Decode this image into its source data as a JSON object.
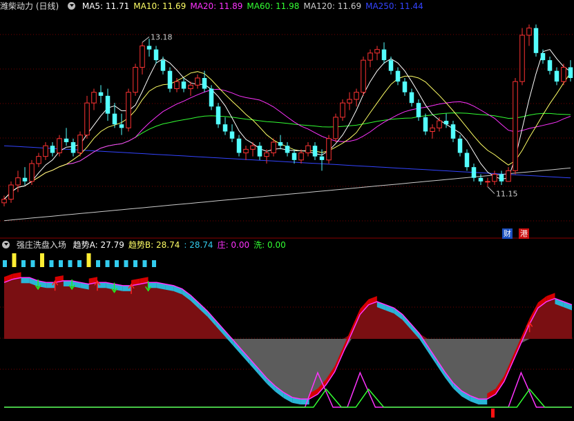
{
  "title": "潍柴动力 (日线)",
  "top_legend": [
    {
      "label": "MA5: 11.71",
      "color": "#ffffff"
    },
    {
      "label": "MA10: 11.69",
      "color": "#ffff66"
    },
    {
      "label": "MA20: 11.89",
      "color": "#ff33ff"
    },
    {
      "label": "MA60: 11.98",
      "color": "#33ff33"
    },
    {
      "label": "MA120: 11.69",
      "color": "#cccccc"
    },
    {
      "label": "MA250: 11.44",
      "color": "#3344ff"
    }
  ],
  "indicator_title": "强庄洗盘入场",
  "bottom_legend": [
    {
      "label": "趋势A: 27.79",
      "color": "#ffffff"
    },
    {
      "label": "趋势B: 28.74",
      "color": "#ffff66"
    },
    {
      "label": ": 28.74",
      "color": "#33ccee"
    },
    {
      "label": "庄: 0.00",
      "color": "#ff33ff"
    },
    {
      "label": "洗: 0.00",
      "color": "#33ff33"
    }
  ],
  "badges": [
    {
      "label": "财",
      "bg": "#1b4fbf"
    },
    {
      "label": "港",
      "bg": "#cc1111"
    }
  ],
  "colors": {
    "up": "#ff3333",
    "down": "#54ffff",
    "fill_red": "#7a0f12",
    "fill_gray": "#5c5c5c",
    "band_cyan": "#2ab4d6",
    "band_red": "#d40000",
    "grid": "#7a0000"
  },
  "chart_data": {
    "type": "candlestick",
    "candles": [
      [
        10.7,
        10.9,
        10.6,
        10.8
      ],
      [
        10.8,
        11.3,
        10.7,
        11.2
      ],
      [
        11.2,
        11.6,
        11.0,
        11.4
      ],
      [
        11.4,
        11.7,
        11.2,
        11.3
      ],
      [
        11.3,
        11.9,
        11.2,
        11.8
      ],
      [
        11.8,
        12.1,
        11.7,
        12.0
      ],
      [
        12.0,
        12.4,
        11.9,
        12.3
      ],
      [
        12.3,
        12.4,
        12.0,
        12.1
      ],
      [
        12.1,
        12.6,
        12.0,
        12.5
      ],
      [
        12.5,
        12.8,
        12.3,
        12.4
      ],
      [
        12.4,
        12.5,
        12.0,
        12.1
      ],
      [
        12.1,
        12.7,
        12.0,
        12.6
      ],
      [
        12.6,
        13.7,
        12.5,
        13.5
      ],
      [
        13.5,
        13.9,
        13.3,
        13.8
      ],
      [
        13.8,
        14.0,
        13.5,
        13.7
      ],
      [
        13.7,
        13.9,
        13.0,
        13.2
      ],
      [
        13.2,
        13.5,
        12.8,
        12.9
      ],
      [
        12.9,
        13.2,
        12.6,
        12.8
      ],
      [
        12.8,
        13.9,
        12.7,
        13.8
      ],
      [
        13.8,
        14.6,
        13.7,
        14.5
      ],
      [
        14.5,
        15.2,
        14.3,
        15.1
      ],
      [
        15.1,
        15.3,
        14.8,
        15.0
      ],
      [
        15.0,
        15.1,
        14.6,
        14.7
      ],
      [
        14.7,
        14.8,
        14.3,
        14.4
      ],
      [
        14.4,
        14.5,
        13.8,
        13.9
      ],
      [
        13.9,
        14.2,
        13.8,
        14.1
      ],
      [
        14.1,
        14.2,
        13.8,
        13.9
      ],
      [
        13.9,
        14.1,
        13.7,
        14.0
      ],
      [
        14.0,
        14.3,
        13.9,
        14.2
      ],
      [
        14.2,
        14.4,
        13.8,
        13.9
      ],
      [
        13.9,
        14.0,
        13.3,
        13.4
      ],
      [
        13.4,
        13.5,
        12.8,
        12.9
      ],
      [
        12.9,
        13.1,
        12.6,
        12.7
      ],
      [
        12.7,
        12.9,
        12.4,
        12.5
      ],
      [
        12.5,
        12.6,
        12.0,
        12.1
      ],
      [
        12.1,
        12.3,
        11.9,
        12.2
      ],
      [
        12.2,
        12.4,
        12.0,
        12.3
      ],
      [
        12.3,
        12.4,
        11.9,
        12.0
      ],
      [
        12.0,
        12.2,
        11.8,
        12.1
      ],
      [
        12.1,
        12.5,
        12.0,
        12.4
      ],
      [
        12.4,
        12.6,
        12.2,
        12.3
      ],
      [
        12.3,
        12.4,
        12.0,
        12.1
      ],
      [
        12.1,
        12.2,
        11.8,
        11.9
      ],
      [
        11.9,
        12.2,
        11.8,
        12.1
      ],
      [
        12.1,
        12.4,
        12.0,
        12.3
      ],
      [
        12.3,
        12.4,
        11.9,
        12.0
      ],
      [
        12.0,
        12.2,
        11.6,
        11.9
      ],
      [
        11.9,
        12.6,
        11.8,
        12.5
      ],
      [
        12.5,
        13.2,
        12.4,
        13.1
      ],
      [
        13.1,
        13.6,
        13.0,
        13.5
      ],
      [
        13.5,
        13.8,
        13.3,
        13.6
      ],
      [
        13.6,
        13.9,
        13.4,
        13.8
      ],
      [
        13.8,
        14.8,
        13.7,
        14.7
      ],
      [
        14.7,
        15.0,
        14.5,
        14.9
      ],
      [
        14.9,
        15.1,
        14.7,
        15.0
      ],
      [
        15.0,
        15.2,
        14.6,
        14.7
      ],
      [
        14.7,
        14.8,
        14.3,
        14.4
      ],
      [
        14.4,
        14.5,
        14.0,
        14.1
      ],
      [
        14.1,
        14.2,
        13.7,
        13.8
      ],
      [
        13.8,
        13.9,
        13.4,
        13.5
      ],
      [
        13.5,
        13.6,
        13.0,
        13.1
      ],
      [
        13.1,
        13.2,
        12.6,
        12.7
      ],
      [
        12.7,
        12.9,
        12.5,
        12.8
      ],
      [
        12.8,
        13.1,
        12.7,
        13.0
      ],
      [
        13.0,
        13.2,
        12.8,
        12.9
      ],
      [
        12.9,
        13.0,
        12.4,
        12.5
      ],
      [
        12.5,
        12.6,
        12.0,
        12.1
      ],
      [
        12.1,
        12.2,
        11.6,
        11.7
      ],
      [
        11.7,
        11.8,
        11.3,
        11.4
      ],
      [
        11.4,
        11.5,
        11.2,
        11.3
      ],
      [
        11.3,
        11.4,
        11.15,
        11.3
      ],
      [
        11.3,
        11.6,
        11.2,
        11.5
      ],
      [
        11.5,
        11.6,
        11.2,
        11.3
      ],
      [
        11.3,
        11.7,
        11.3,
        11.6
      ],
      [
        11.6,
        14.2,
        11.5,
        14.1
      ],
      [
        14.1,
        15.6,
        14.0,
        15.4
      ],
      [
        15.4,
        15.7,
        15.1,
        15.6
      ],
      [
        15.6,
        15.7,
        14.8,
        14.9
      ],
      [
        14.9,
        15.0,
        14.6,
        14.7
      ],
      [
        14.7,
        14.8,
        14.3,
        14.4
      ],
      [
        14.4,
        14.5,
        14.0,
        14.1
      ],
      [
        14.1,
        14.6,
        14.0,
        14.5
      ],
      [
        14.5,
        14.7,
        14.1,
        14.2
      ]
    ],
    "annotations": [
      {
        "label": "13.18",
        "index": 20,
        "kind": "high"
      },
      {
        "label": "11.15",
        "index": 70,
        "kind": "low"
      }
    ],
    "indicator": {
      "trend": [
        76,
        78,
        79,
        79,
        77,
        76,
        76,
        77,
        77,
        76,
        75,
        76,
        76,
        75,
        74,
        74,
        75,
        76,
        76,
        75,
        74,
        72,
        68,
        63,
        58,
        52,
        46,
        40,
        34,
        28,
        22,
        16,
        11,
        7,
        4,
        3,
        3,
        6,
        12,
        20,
        32,
        44,
        56,
        62,
        64,
        62,
        60,
        56,
        50,
        44,
        36,
        28,
        20,
        13,
        8,
        5,
        3,
        3,
        6,
        14,
        26,
        38,
        50,
        60,
        64,
        66,
        64,
        62
      ],
      "zhuang_peaks": [
        37,
        42,
        61
      ],
      "xi_peaks": [
        38,
        43,
        62
      ],
      "arrows_down": [
        4,
        8,
        13,
        17
      ],
      "arrows_up": [
        6,
        11,
        15,
        62
      ]
    }
  }
}
